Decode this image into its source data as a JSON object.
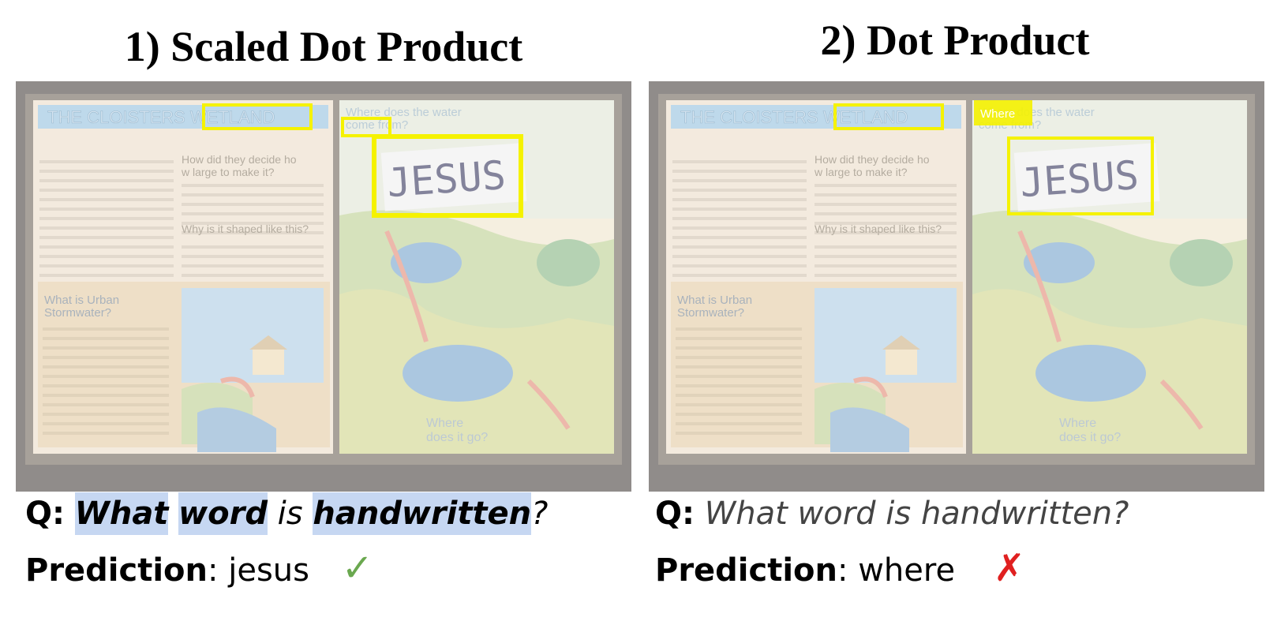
{
  "panels": [
    {
      "title": "1) Scaled Dot Product",
      "question_prefix": "Q:",
      "question_words": [
        "What",
        "word",
        "is",
        "handwritten",
        "?"
      ],
      "prediction_label": "Prediction",
      "prediction_sep": ":",
      "prediction_value": "jesus",
      "result_icon": "check-icon",
      "result_glyph": "✓",
      "result_color": "#6aa84f"
    },
    {
      "title": "2) Dot Product",
      "question_prefix": "Q:",
      "question_text": "What word is handwritten?",
      "prediction_label": "Prediction",
      "prediction_sep": ":",
      "prediction_value": "where",
      "result_icon": "cross-icon",
      "result_glyph": "✗",
      "result_color": "#e02020"
    }
  ],
  "scene": {
    "sign_header": "THE CLOISTERS WETLAND",
    "water_question": "Where does the water come from?",
    "handwritten_word": "JESUS",
    "decide_heading": "How did they decide how large to make it?",
    "shape_heading": "Why is it shaped like this?",
    "urban_heading": "What is Urban Stormwater?",
    "where_go": "Where does it go?"
  },
  "colors": {
    "highlight_box": "#f5f200",
    "word_highlight": "#c6d7f2"
  }
}
